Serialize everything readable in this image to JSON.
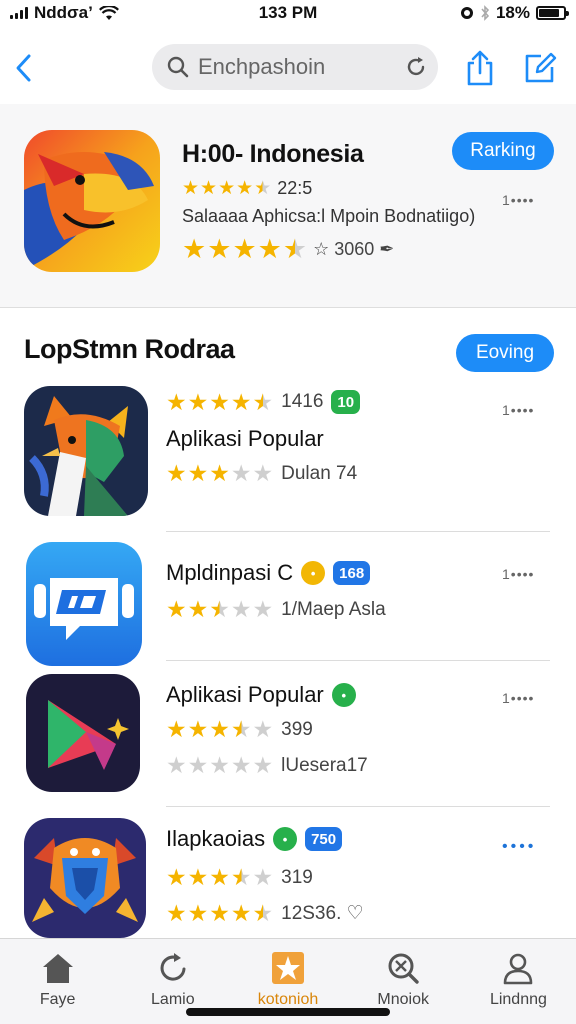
{
  "status_bar": {
    "carrier": "Nddσa’",
    "time": "133 PM",
    "battery": "18%",
    "battery_level": 0.82
  },
  "nav": {
    "search_placeholder": "Enchpashoin",
    "icons": [
      "back-icon",
      "search-icon",
      "refresh-icon",
      "share-icon",
      "compose-icon"
    ]
  },
  "featured": {
    "title": "H:00- Indonesia",
    "button_label": "Rarking",
    "rating_value": "22:5",
    "rating_stars": 4.5,
    "subtitle": "Salaaaa Aphicsa:l Mpoin Bodnatiigo)",
    "rating2_stars": 4.5,
    "rating2_text": "☆ 3060 ✒",
    "more_label": "1••••"
  },
  "section": {
    "title": "LopStmn Rodraa",
    "button_label": "Eoving"
  },
  "apps": [
    {
      "stars_line1": 4.5,
      "count": "1416",
      "badge": "10",
      "name": "Aplikasi Popular",
      "stars_line2": 3,
      "sub": "Dulan 74",
      "more": "1••••"
    },
    {
      "name": "Mpldinpasi C",
      "circle": "•",
      "badge": "168",
      "stars_line2": 2.5,
      "sub": "1/Maep Asla",
      "more": "1••••"
    },
    {
      "name": "Aplikasi Popular",
      "circle": "•",
      "stars_line1": 3.5,
      "count": "399",
      "stars_line2": 0,
      "sub": "lUesera17",
      "more": "1••••"
    },
    {
      "name": "Ilapkaoias",
      "circle": "•",
      "badge": "750",
      "stars_line1": 3.5,
      "count": "319",
      "stars_line2": 4.5,
      "sub": "12S36. ♡",
      "more": "••••"
    }
  ],
  "tabs": [
    {
      "label": "Faye",
      "icon": "home-icon",
      "active": false
    },
    {
      "label": "Lamio",
      "icon": "refresh-icon",
      "active": false
    },
    {
      "label": "kotonioh",
      "icon": "star-box-icon",
      "active": true
    },
    {
      "label": "Mnoiok",
      "icon": "search-icon",
      "active": false
    },
    {
      "label": "Lindnng",
      "icon": "person-icon",
      "active": false
    }
  ],
  "colors": {
    "accent": "#1d8cf8",
    "star": "#f5b400",
    "active_tab": "#d9860b"
  }
}
